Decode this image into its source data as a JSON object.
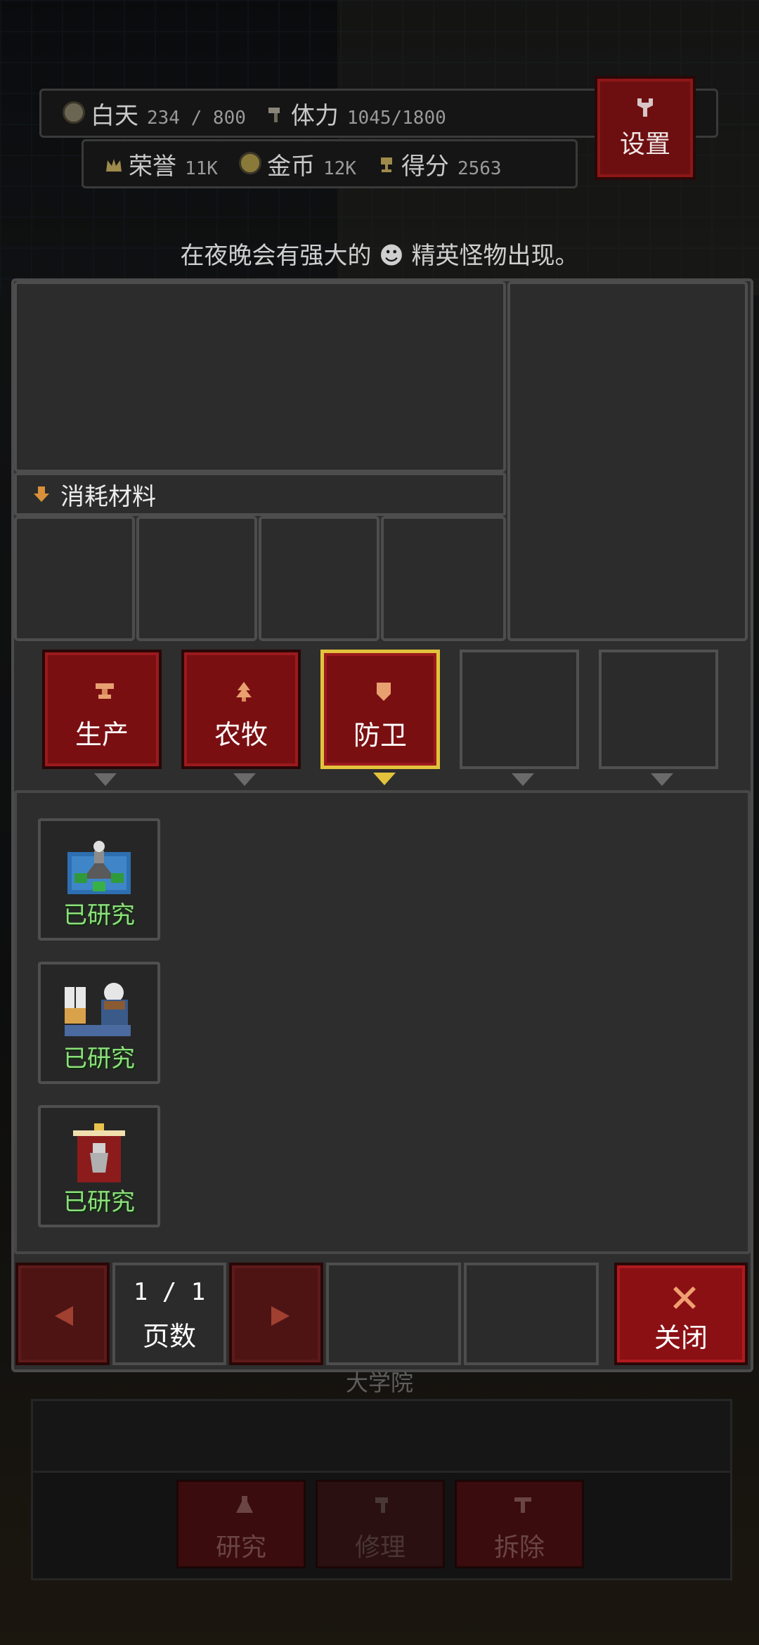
{
  "hud": {
    "daytime_label": "白天",
    "daytime_value": "234 / 800",
    "stamina_label": "体力",
    "stamina_value": "1045/1800",
    "honor_label": "荣誉",
    "honor_value": "11K",
    "gold_label": "金币",
    "gold_value": "12K",
    "score_label": "得分",
    "score_value": "2563",
    "settings_label": "设置"
  },
  "notice": "在夜晚会有强大的 ☻ 精英怪物出现。",
  "materials_header": "消耗材料",
  "tabs": [
    {
      "label": "生产",
      "icon": "anvil-icon"
    },
    {
      "label": "农牧",
      "icon": "tree-icon"
    },
    {
      "label": "防卫",
      "icon": "shield-icon",
      "active": true
    }
  ],
  "items": [
    {
      "icon": "cannon-tower-icon",
      "status": "已研究"
    },
    {
      "icon": "soldier-barracks-icon",
      "status": "已研究"
    },
    {
      "icon": "banner-icon",
      "status": "已研究"
    }
  ],
  "pagination": {
    "current": "1 / 1",
    "label": "页数"
  },
  "close_label": "关闭",
  "building_name": "大学院",
  "actions": {
    "research": "研究",
    "repair": "修理",
    "demolish": "拆除"
  },
  "colors": {
    "accent_red": "#7a0f12",
    "active_gold": "#e3c33b",
    "researched_green": "#8ce07a"
  }
}
